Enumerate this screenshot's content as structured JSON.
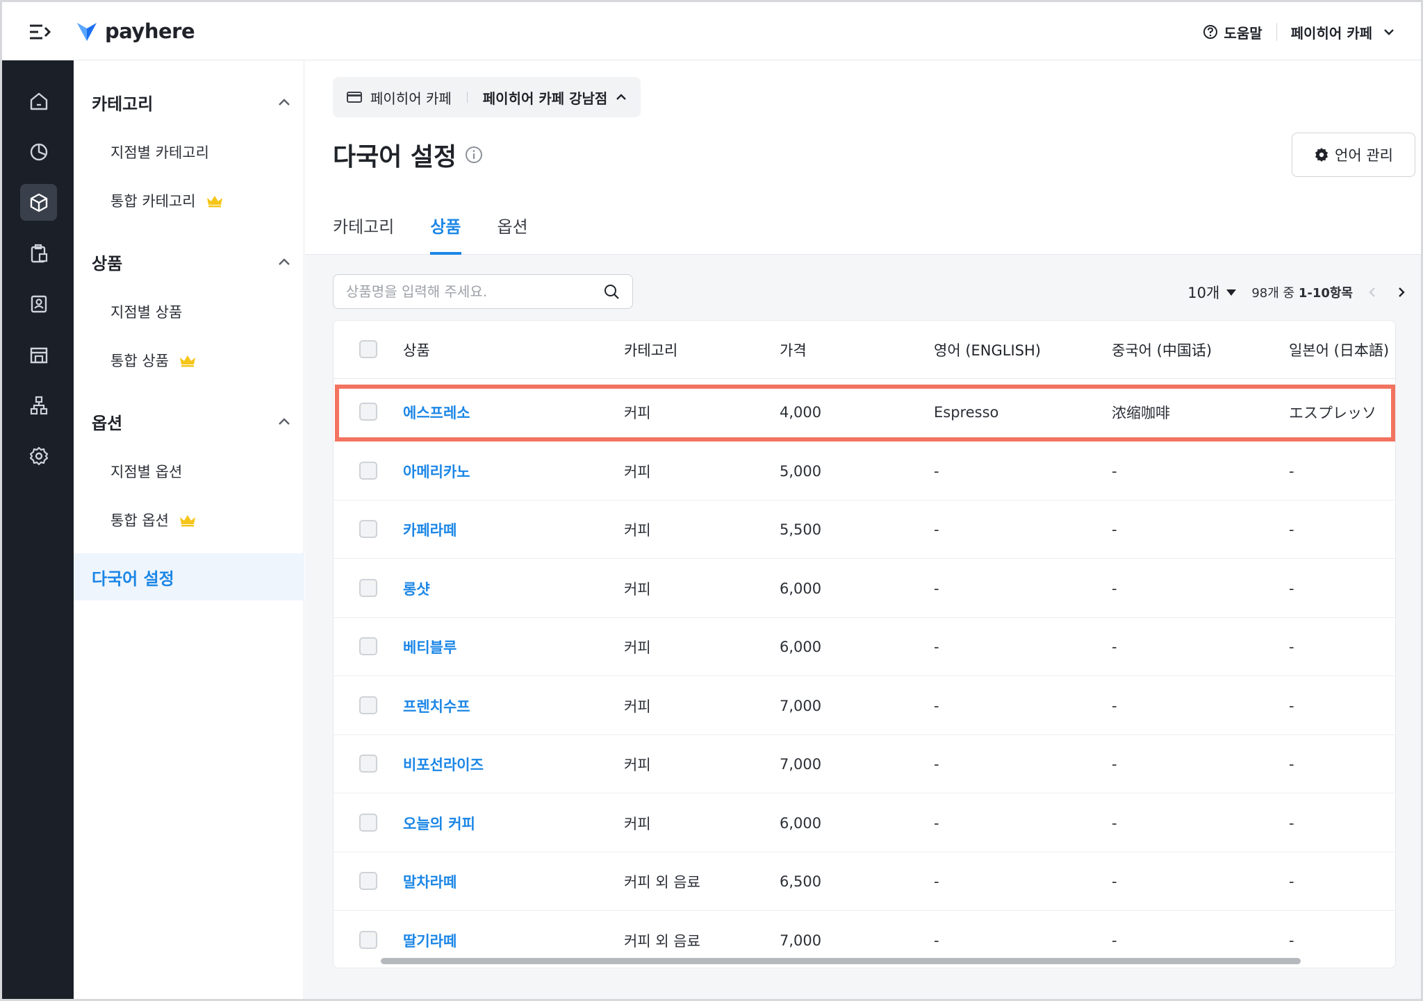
{
  "brand": {
    "name": "payhere",
    "accent": "#1b86e6"
  },
  "header": {
    "help_label": "도움말",
    "store_label": "페이히어 카페"
  },
  "rail": {
    "items": [
      "home-icon",
      "chart-pie-icon",
      "box-icon",
      "clipboard-icon",
      "contact-icon",
      "store-icon",
      "org-chart-icon",
      "gear-icon"
    ],
    "active_index": 2
  },
  "subnav": {
    "sections": [
      {
        "title": "카테고리",
        "items": [
          "지점별 카테고리",
          "통합 카테고리"
        ]
      },
      {
        "title": "상품",
        "items": [
          "지점별 상품",
          "통합 상품"
        ]
      },
      {
        "title": "옵션",
        "items": [
          "지점별 옵션",
          "통합 옵션"
        ]
      }
    ],
    "active": "다국어 설정"
  },
  "breadcrumb": {
    "brand": "페이히어 카페",
    "branch": "페이히어 카페 강남점"
  },
  "page": {
    "title": "다국어 설정",
    "lang_button": "언어 관리"
  },
  "tabs": [
    {
      "label": "카테고리"
    },
    {
      "label": "상품"
    },
    {
      "label": "옵션"
    }
  ],
  "search": {
    "placeholder": "상품명을 입력해 주세요.",
    "value": ""
  },
  "pager": {
    "page_size": "10개",
    "total_prefix": "98개 중",
    "range": "1-10항목"
  },
  "table": {
    "columns": [
      "상품",
      "카테고리",
      "가격",
      "영어 (ENGLISH)",
      "중국어 (中国话)",
      "일본어 (日本語)"
    ],
    "rows": [
      {
        "name": "에스프레소",
        "category": "커피",
        "price": "4,000",
        "en": "Espresso",
        "zh": "浓缩咖啡",
        "ja": "エスプレッソ"
      },
      {
        "name": "아메리카노",
        "category": "커피",
        "price": "5,000",
        "en": "-",
        "zh": "-",
        "ja": "-"
      },
      {
        "name": "카페라떼",
        "category": "커피",
        "price": "5,500",
        "en": "-",
        "zh": "-",
        "ja": "-"
      },
      {
        "name": "롱샷",
        "category": "커피",
        "price": "6,000",
        "en": "-",
        "zh": "-",
        "ja": "-"
      },
      {
        "name": "베티블루",
        "category": "커피",
        "price": "6,000",
        "en": "-",
        "zh": "-",
        "ja": "-"
      },
      {
        "name": "프렌치수프",
        "category": "커피",
        "price": "7,000",
        "en": "-",
        "zh": "-",
        "ja": "-"
      },
      {
        "name": "비포선라이즈",
        "category": "커피",
        "price": "7,000",
        "en": "-",
        "zh": "-",
        "ja": "-"
      },
      {
        "name": "오늘의 커피",
        "category": "커피",
        "price": "6,000",
        "en": "-",
        "zh": "-",
        "ja": "-"
      },
      {
        "name": "말차라떼",
        "category": "커피 외 음료",
        "price": "6,500",
        "en": "-",
        "zh": "-",
        "ja": "-"
      },
      {
        "name": "딸기라떼",
        "category": "커피 외 음료",
        "price": "7,000",
        "en": "-",
        "zh": "-",
        "ja": "-"
      }
    ],
    "highlight_color": "#f2735f"
  }
}
